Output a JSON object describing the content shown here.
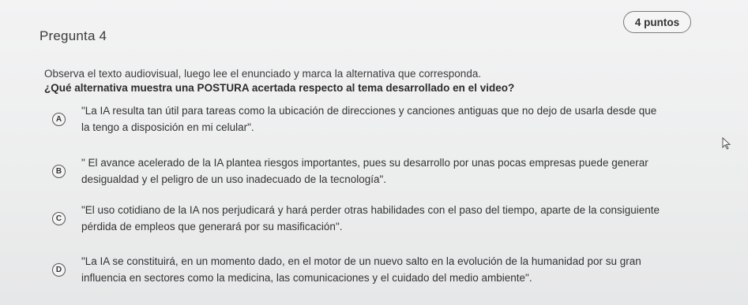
{
  "question": {
    "title": "Pregunta 4",
    "points": "4 puntos",
    "instruction": "Observa el texto audiovisual, luego lee el enunciado y marca la alternativa que corresponda.",
    "prompt": "¿Qué alternativa muestra una POSTURA acertada respecto al tema desarrollado en el video?"
  },
  "options": [
    {
      "letter": "A",
      "line1": "\"La IA resulta tan útil para tareas como la ubicación de direcciones y canciones antiguas que no dejo de usarla desde que",
      "line2": "la tengo a disposición en mi celular\"."
    },
    {
      "letter": "B",
      "line1": "\" El avance acelerado de la IA plantea riesgos importantes, pues su desarrollo por unas pocas empresas puede generar",
      "line2": "desigualdad y el peligro de un uso inadecuado de la tecnología\"."
    },
    {
      "letter": "C",
      "line1": "\"El uso cotidiano de la IA nos perjudicará y hará perder otras habilidades con el paso del tiempo, aparte de la consiguiente",
      "line2": "pérdida de empleos que generará por su masificación\"."
    },
    {
      "letter": "D",
      "line1": "\"La IA se constituirá, en un momento dado, en el motor de un nuevo salto en la evolución de la humanidad por su gran",
      "line2": "influencia en sectores como la medicina, las comunicaciones y el cuidado del medio ambiente\"."
    }
  ]
}
